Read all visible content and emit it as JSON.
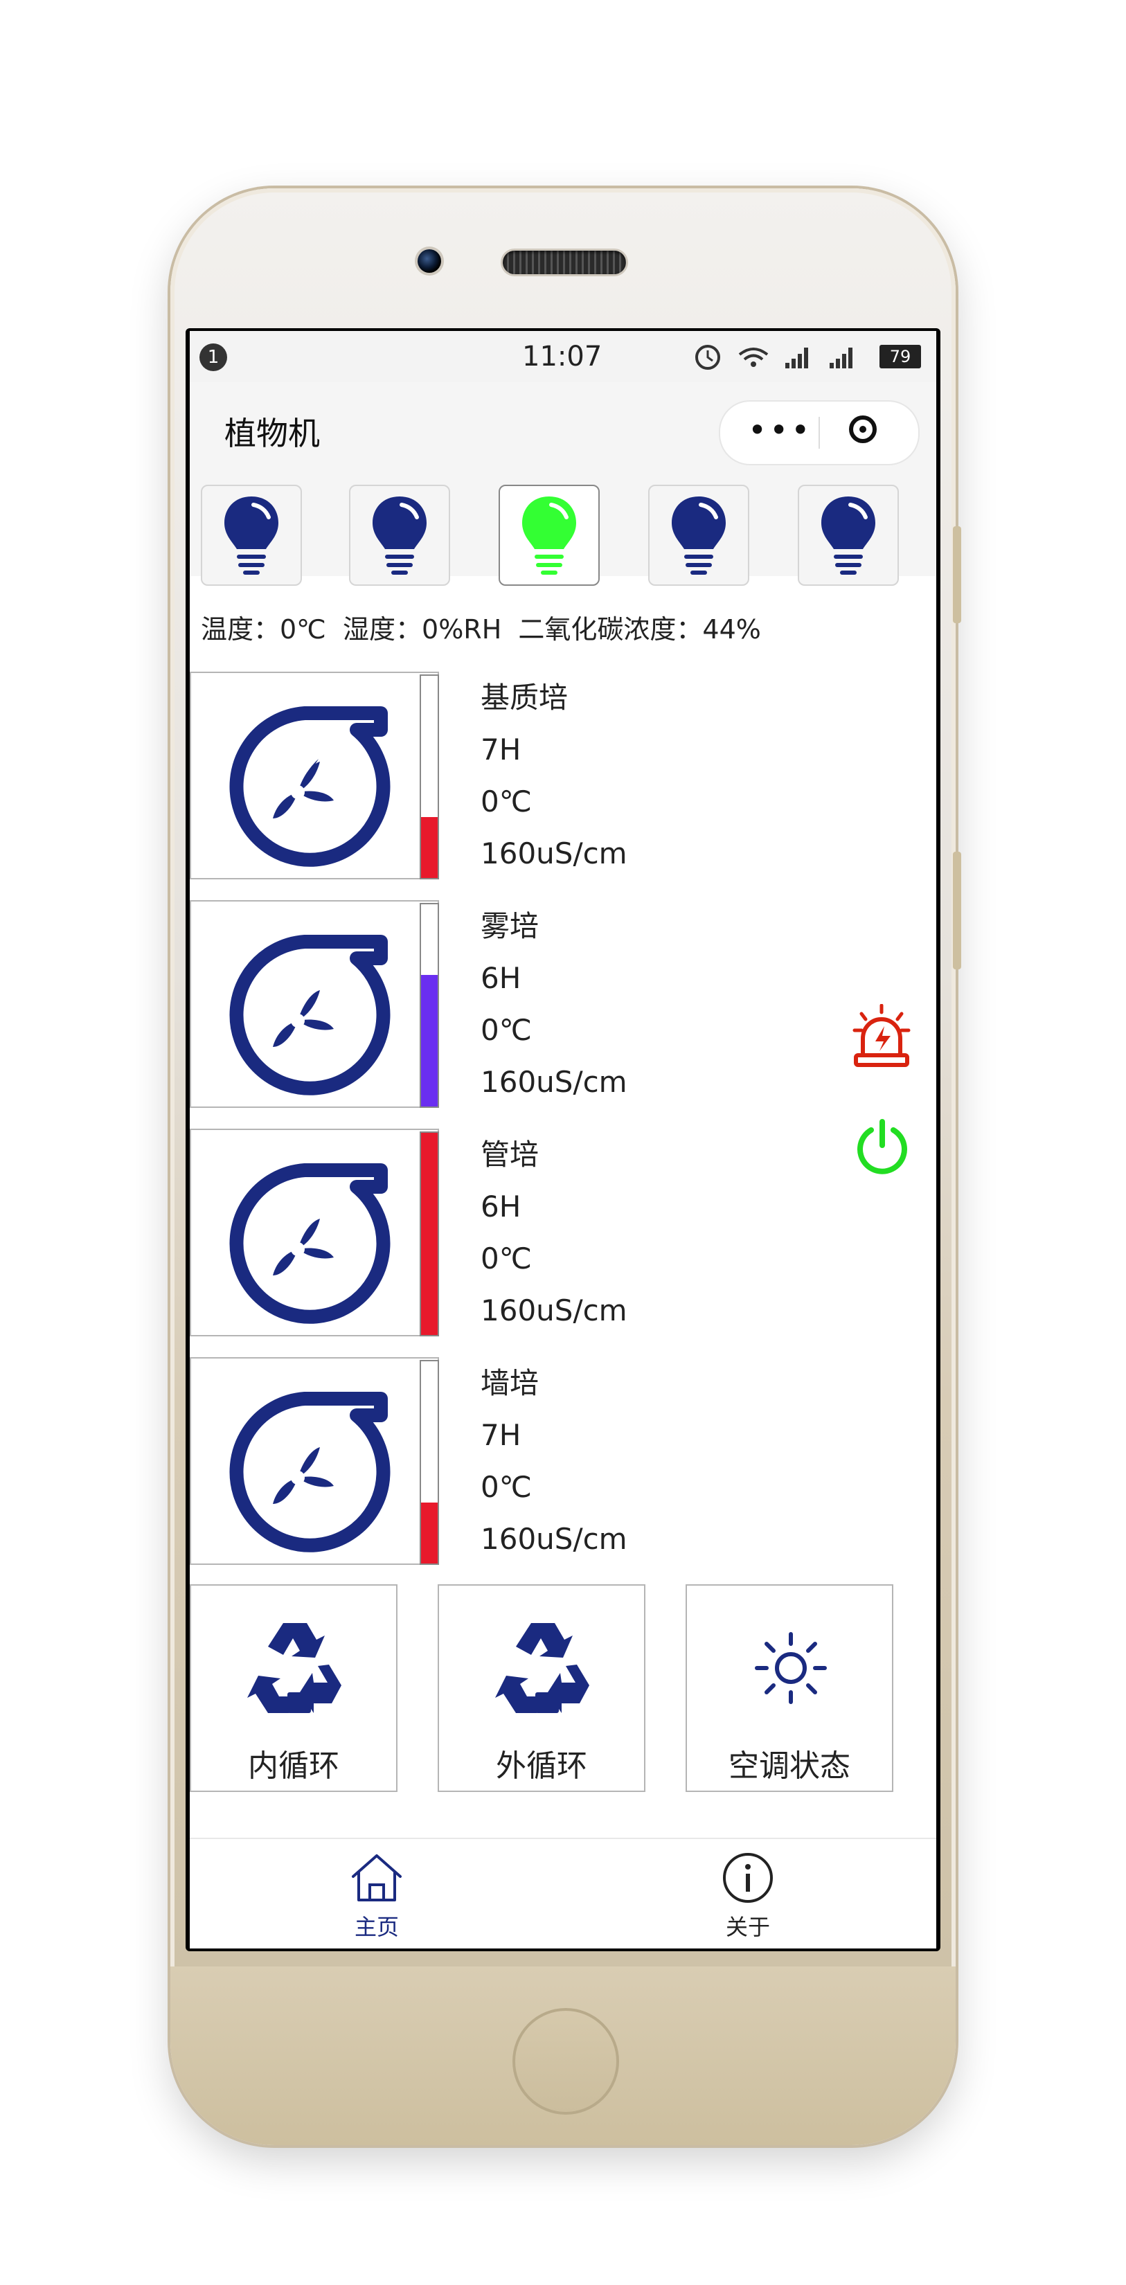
{
  "status_bar": {
    "notification_count": "1",
    "time": "11:07",
    "battery": "79"
  },
  "nav": {
    "title": "植物机",
    "more_icon": "more-dots-icon",
    "close_icon": "target-icon"
  },
  "bulbs": [
    {
      "state": "off",
      "color": "#1a2a80"
    },
    {
      "state": "off",
      "color": "#1a2a80"
    },
    {
      "state": "on",
      "color": "#33ff33"
    },
    {
      "state": "off",
      "color": "#1a2a80"
    },
    {
      "state": "off",
      "color": "#1a2a80"
    }
  ],
  "environment": "温度：0℃  湿度：0%RH  二氧化碳浓度：44%",
  "devices": [
    {
      "name": "基质培",
      "hours": "7H",
      "temp": "0℃",
      "ec": "160uS/cm",
      "level": 0.3,
      "level_color": "#e8192c"
    },
    {
      "name": "雾培",
      "hours": "6H",
      "temp": "0℃",
      "ec": "160uS/cm",
      "level": 0.65,
      "level_color": "#6a2ef0"
    },
    {
      "name": "管培",
      "hours": "6H",
      "temp": "0℃",
      "ec": "160uS/cm",
      "level": 1.0,
      "level_color": "#e8192c"
    },
    {
      "name": "墙培",
      "hours": "7H",
      "temp": "0℃",
      "ec": "160uS/cm",
      "level": 0.3,
      "level_color": "#e8192c"
    }
  ],
  "side_icons": {
    "alarm": "alarm-icon",
    "power": "power-icon",
    "alarm_color": "#d9230f",
    "power_color": "#22dd22"
  },
  "controls": [
    {
      "label": "内循环",
      "icon": "recycle-icon"
    },
    {
      "label": "外循环",
      "icon": "recycle-icon"
    },
    {
      "label": "空调状态",
      "icon": "sun-icon"
    }
  ],
  "tabs": [
    {
      "label": "主页",
      "icon": "home-icon",
      "active": true
    },
    {
      "label": "关于",
      "icon": "info-icon",
      "active": false
    }
  ],
  "colors": {
    "primary": "#1a2a80",
    "active_tab": "#1a2a80"
  }
}
